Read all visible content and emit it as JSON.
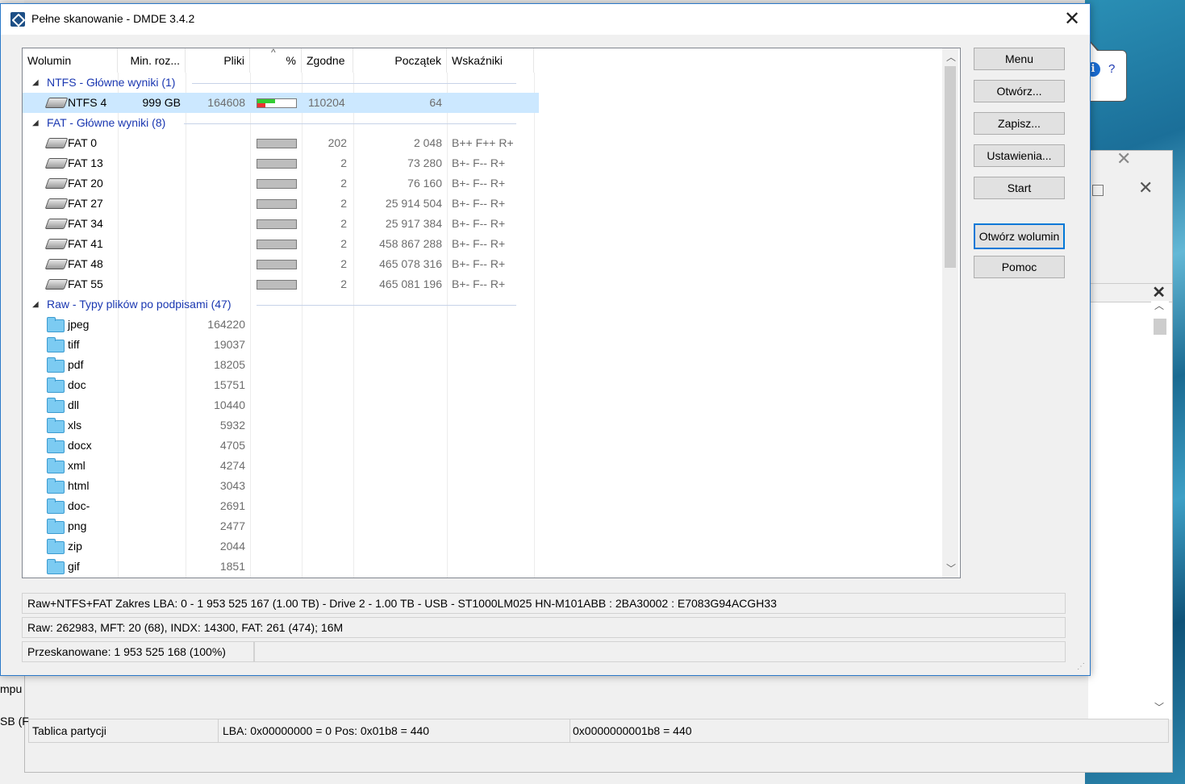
{
  "window": {
    "title": "Pełne skanowanie - DMDE 3.4.2"
  },
  "columns": {
    "wolumin": "Wolumin",
    "min_roz": "Min. roz...",
    "pliki": "Pliki",
    "percent": "%",
    "zgodne": "Zgodne",
    "poczatek": "Początek",
    "wskazniki": "Wskaźniki"
  },
  "groups": {
    "ntfs": "NTFS - Główne wyniki (1)",
    "fat": "FAT - Główne wyniki (8)",
    "raw": "Raw - Typy plików po podpisami (47)"
  },
  "ntfs_rows": [
    {
      "name": "NTFS 4",
      "min": "999 GB",
      "files": "164608",
      "zgodne": "110204",
      "start": "64",
      "flags": "",
      "progress": 0.45
    }
  ],
  "fat_rows": [
    {
      "name": "FAT 0",
      "zgodne": "202",
      "start": "2 048",
      "flags": "B++ F++ R+"
    },
    {
      "name": "FAT 13",
      "zgodne": "2",
      "start": "73 280",
      "flags": "B+- F-- R+"
    },
    {
      "name": "FAT 20",
      "zgodne": "2",
      "start": "76 160",
      "flags": "B+- F-- R+"
    },
    {
      "name": "FAT 27",
      "zgodne": "2",
      "start": "25 914 504",
      "flags": "B+- F-- R+"
    },
    {
      "name": "FAT 34",
      "zgodne": "2",
      "start": "25 917 384",
      "flags": "B+- F-- R+"
    },
    {
      "name": "FAT 41",
      "zgodne": "2",
      "start": "458 867 288",
      "flags": "B+- F-- R+"
    },
    {
      "name": "FAT 48",
      "zgodne": "2",
      "start": "465 078 316",
      "flags": "B+- F-- R+"
    },
    {
      "name": "FAT 55",
      "zgodne": "2",
      "start": "465 081 196",
      "flags": "B+- F-- R+"
    }
  ],
  "raw_rows": [
    {
      "name": "jpeg",
      "files": "164220"
    },
    {
      "name": "tiff",
      "files": "19037"
    },
    {
      "name": "pdf",
      "files": "18205"
    },
    {
      "name": "doc",
      "files": "15751"
    },
    {
      "name": "dll",
      "files": "10440"
    },
    {
      "name": "xls",
      "files": "5932"
    },
    {
      "name": "docx",
      "files": "4705"
    },
    {
      "name": "xml",
      "files": "4274"
    },
    {
      "name": "html",
      "files": "3043"
    },
    {
      "name": "doc-",
      "files": "2691"
    },
    {
      "name": "png",
      "files": "2477"
    },
    {
      "name": "zip",
      "files": "2044"
    },
    {
      "name": "gif",
      "files": "1851"
    }
  ],
  "buttons": {
    "menu": "Menu",
    "open": "Otwórz...",
    "save": "Zapisz...",
    "settings": "Ustawienia...",
    "start": "Start",
    "open_volume": "Otwórz wolumin",
    "help": "Pomoc"
  },
  "status": {
    "line1": "Raw+NTFS+FAT Zakres LBA: 0 - 1 953 525 167 (1.00 TB) - Drive 2 - 1.00 TB - USB - ST1000LM025 HN-M101ABB : 2BA30002 : E7083G94ACGH33",
    "line2": "Raw: 262983, MFT: 20 (68), INDX: 14300, FAT: 261 (474); 16M",
    "line3": "Przeskanowane: 1 953 525 168 (100%)"
  },
  "tooltip": {
    "text": "?"
  },
  "background": {
    "left_text1": "mpu",
    "left_text2": "SB (F",
    "status_seg1": "Tablica partycji",
    "status_seg2": "LBA: 0x00000000 = 0  Pos: 0x01b8 = 440",
    "status_seg3": "0x0000000001b8 = 440"
  },
  "colors": {
    "accent": "#0078d7",
    "group_text": "#1a37b1",
    "selected_row": "#cce8ff"
  }
}
